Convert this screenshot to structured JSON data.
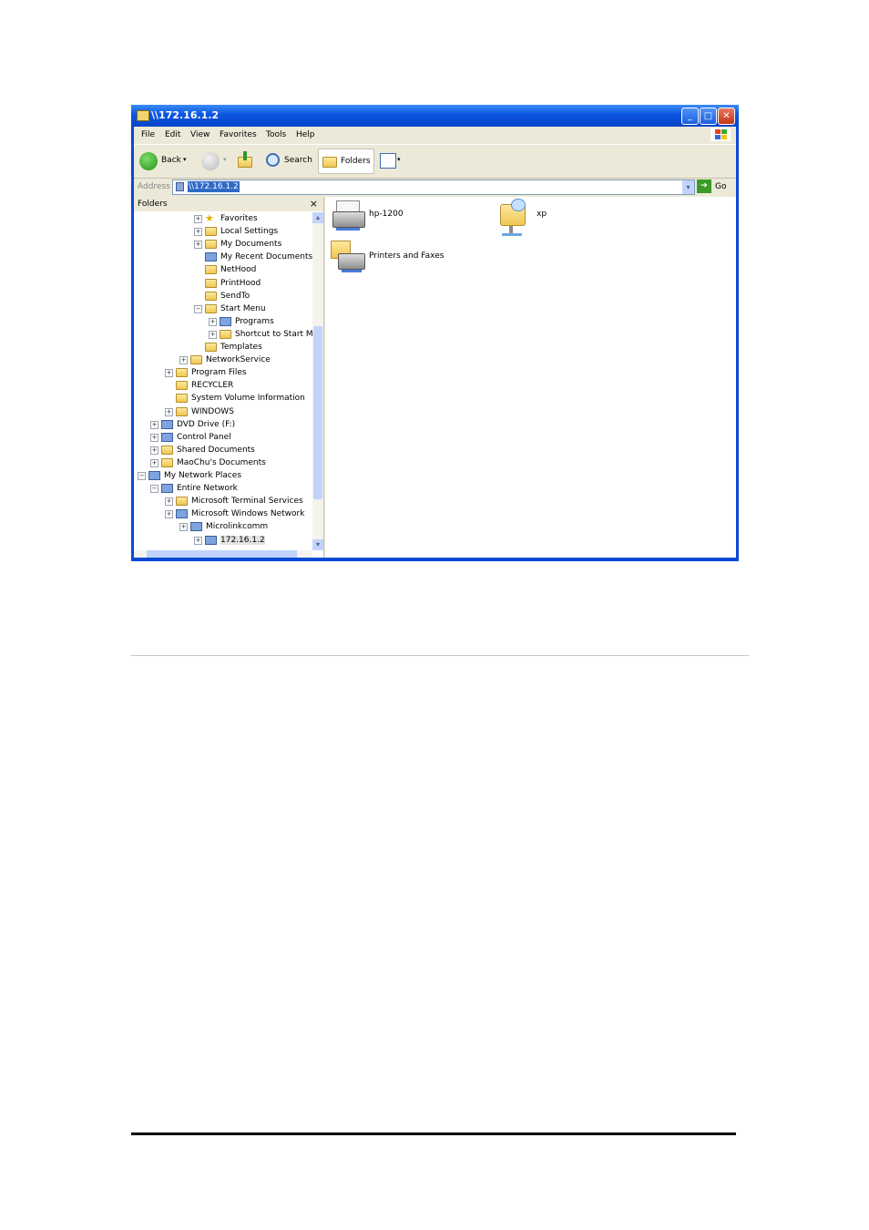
{
  "window": {
    "title": "\\\\172.16.1.2",
    "address_label": "Address",
    "address_value": "\\\\172.16.1.2",
    "go_label": "Go"
  },
  "menu": [
    "File",
    "Edit",
    "View",
    "Favorites",
    "Tools",
    "Help"
  ],
  "toolbar": {
    "back_label": "Back",
    "search_label": "Search",
    "folders_label": "Folders"
  },
  "folders_pane": {
    "header": "Folders",
    "close": "×",
    "tree": [
      {
        "label": "Favorites",
        "expander": "+",
        "icon": "star-icon"
      },
      {
        "label": "Local Settings",
        "expander": "+",
        "icon": "folder-icon"
      },
      {
        "label": "My Documents",
        "expander": "+",
        "icon": "folder-icon"
      },
      {
        "label": "My Recent Documents",
        "expander": "",
        "icon": "recent-docs-icon"
      },
      {
        "label": "NetHood",
        "expander": "",
        "icon": "folder-icon"
      },
      {
        "label": "PrintHood",
        "expander": "",
        "icon": "folder-icon"
      },
      {
        "label": "SendTo",
        "expander": "",
        "icon": "folder-icon"
      },
      {
        "label": "Start Menu",
        "expander": "−",
        "icon": "folder-icon"
      },
      {
        "label": "Programs",
        "expander": "+",
        "icon": "programs-icon"
      },
      {
        "label": "Shortcut to Start Mer",
        "expander": "+",
        "icon": "folder-icon"
      },
      {
        "label": "Templates",
        "expander": "",
        "icon": "folder-icon"
      },
      {
        "label": "NetworkService",
        "expander": "+",
        "icon": "folder-icon"
      },
      {
        "label": "Program Files",
        "expander": "+",
        "icon": "folder-icon"
      },
      {
        "label": "RECYCLER",
        "expander": "",
        "icon": "folder-icon"
      },
      {
        "label": "System Volume Information",
        "expander": "",
        "icon": "folder-icon"
      },
      {
        "label": "WINDOWS",
        "expander": "+",
        "icon": "folder-icon"
      },
      {
        "label": "DVD Drive (F:)",
        "expander": "+",
        "icon": "dvd-drive-icon"
      },
      {
        "label": "Control Panel",
        "expander": "+",
        "icon": "control-panel-icon"
      },
      {
        "label": "Shared Documents",
        "expander": "+",
        "icon": "folder-icon"
      },
      {
        "label": "MaoChu's Documents",
        "expander": "+",
        "icon": "folder-icon"
      },
      {
        "label": "My Network Places",
        "expander": "−",
        "icon": "network-places-icon"
      },
      {
        "label": "Entire Network",
        "expander": "−",
        "icon": "entire-network-icon"
      },
      {
        "label": "Microsoft Terminal Services",
        "expander": "+",
        "icon": "folder-icon"
      },
      {
        "label": "Microsoft Windows Network",
        "expander": "+",
        "icon": "windows-network-icon"
      },
      {
        "label": "Microlinkcomm",
        "expander": "+",
        "icon": "workgroup-icon"
      },
      {
        "label": "172.16.1.2",
        "expander": "+",
        "icon": "computer-icon"
      }
    ]
  },
  "content": {
    "items": [
      {
        "label": "hp-1200",
        "icon": "printer-icon"
      },
      {
        "label": "xp",
        "icon": "shared-folder-icon"
      },
      {
        "label": "Printers and Faxes",
        "icon": "printers-faxes-icon"
      }
    ]
  },
  "colors": {
    "titlebar": "#0a55e0",
    "selection": "#316ac5",
    "folder": "#efc651"
  }
}
